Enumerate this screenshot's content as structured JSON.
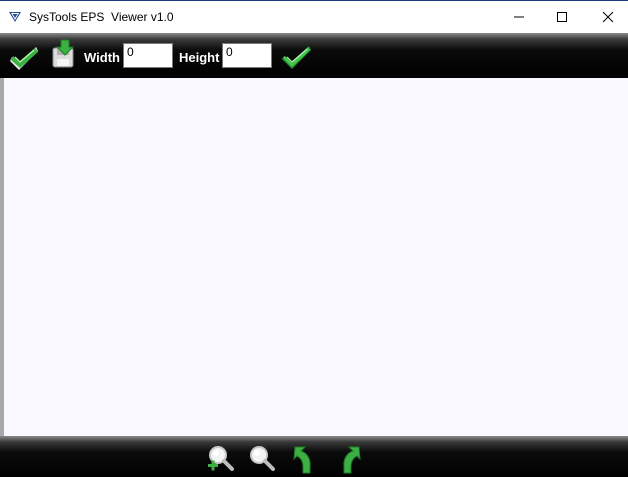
{
  "window": {
    "title": "SysTools EPS  Viewer v1.0"
  },
  "toolbar": {
    "open_icon": "open-checkmark-icon",
    "save_icon": "save-disk-icon",
    "width_label": "Width",
    "width_value": "0",
    "height_label": "Height",
    "height_value": "0",
    "apply_icon": "green-checkmark-icon"
  },
  "bottombar": {
    "zoom_in_icon": "zoom-in-icon",
    "zoom_out_icon": "zoom-out-icon",
    "rotate_left_icon": "rotate-left-icon",
    "rotate_right_icon": "rotate-right-icon"
  },
  "colors": {
    "toolbar_bg": "#000000",
    "canvas_bg": "#f8f8fe",
    "accent_green": "#3cb043"
  }
}
